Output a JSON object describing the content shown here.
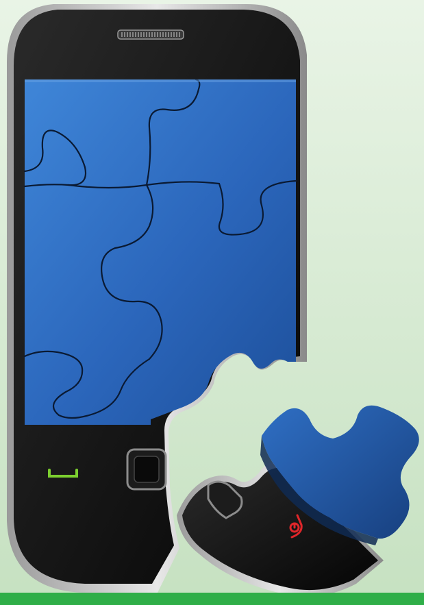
{
  "colors": {
    "background_top": "#e6f2e3",
    "background_bottom": "#c7e2c2",
    "screen_blue": "#2f6fc4",
    "screen_blue_dark": "#1d4f9a",
    "phone_body": "#121212",
    "chrome_rim": "#b8b8b8",
    "call_green": "#7ccf2f",
    "end_call_red": "#e0262a",
    "footer_green": "#2fae48"
  },
  "icons": {
    "call_button": "phone-call-icon",
    "end_button": "phone-hangup-icon",
    "speaker": "speaker-grille-icon",
    "home": "home-button-icon"
  }
}
